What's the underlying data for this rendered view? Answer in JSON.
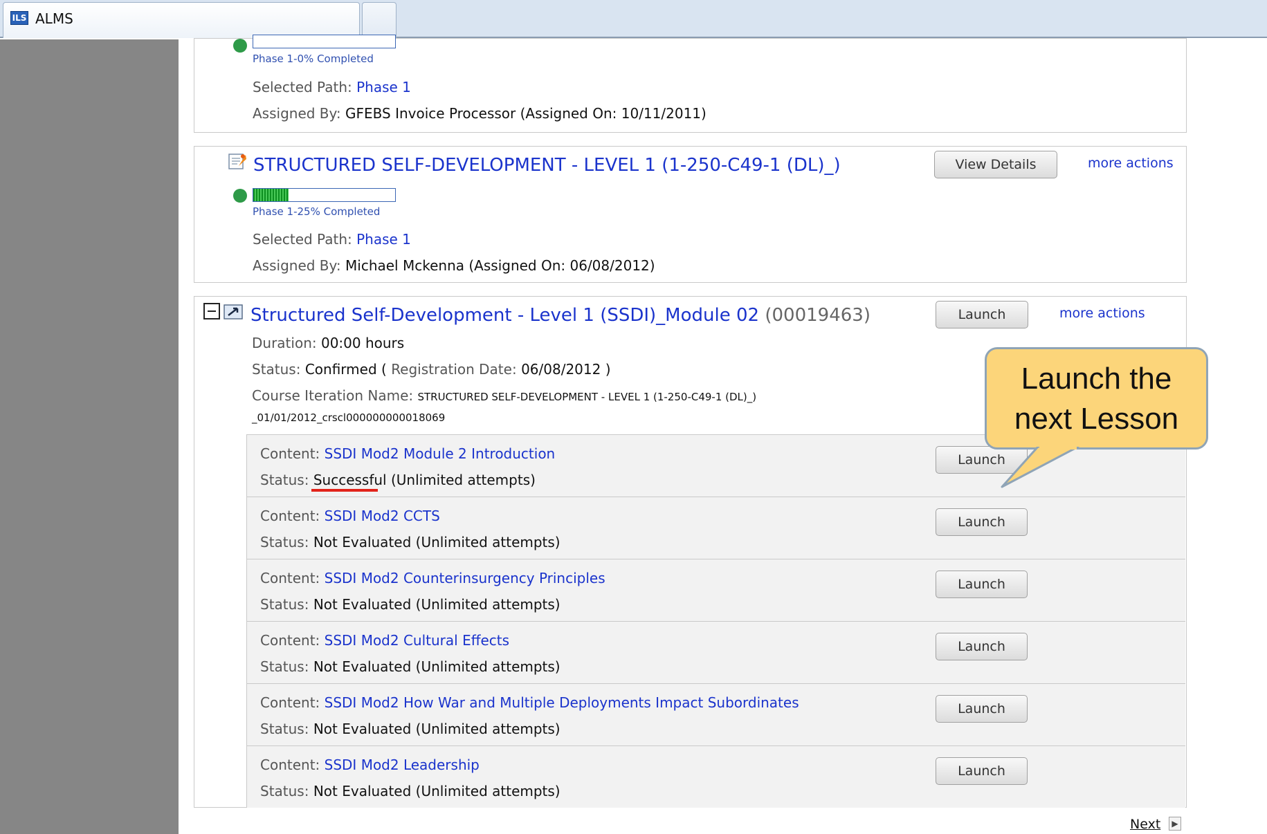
{
  "browser": {
    "tab_title": "ALMS",
    "tab_icon": "ILS"
  },
  "card_top": {
    "progress_label": "Phase 1-0% Completed",
    "progress_percent": 0,
    "selected_path_label": "Selected Path:",
    "selected_path_value": "Phase 1",
    "assigned_by_label": "Assigned By:",
    "assigned_by_value": "GFEBS Invoice Processor (Assigned On: 10/11/2011)"
  },
  "card_ssd": {
    "title": "STRUCTURED SELF-DEVELOPMENT - LEVEL 1 (1-250-C49-1 (DL)_)",
    "view_details": "View Details",
    "more_actions": "more actions",
    "progress_label": "Phase 1-25% Completed",
    "progress_percent": 25,
    "selected_path_label": "Selected Path:",
    "selected_path_value": "Phase 1",
    "assigned_by_label": "Assigned By:",
    "assigned_by_value": "Michael Mckenna (Assigned On: 06/08/2012)"
  },
  "module": {
    "title": "Structured Self-Development - Level 1 (SSDI)_Module 02",
    "code": "(00019463)",
    "launch": "Launch",
    "more_actions": "more actions",
    "duration_label": "Duration:",
    "duration_value": "00:00 hours",
    "status_label": "Status:",
    "status_value": "Confirmed",
    "paren_open": "(",
    "reg_label": "Registration Date:",
    "reg_value": "06/08/2012",
    "paren_close": ")",
    "iteration_label": "Course Iteration Name:",
    "iteration_value_1": "STRUCTURED SELF-DEVELOPMENT - LEVEL 1 (1-250-C49-1 (DL)_)",
    "iteration_value_2": "_01/01/2012_crscl000000000018069",
    "contents": [
      {
        "content_label": "Content:",
        "name": "SSDI Mod2 Module 2 Introduction",
        "status_label": "Status:",
        "status": "Successful",
        "attempts": "(Unlimited attempts)",
        "launch": "Launch"
      },
      {
        "content_label": "Content:",
        "name": "SSDI Mod2 CCTS",
        "status_label": "Status:",
        "status": "Not Evaluated",
        "attempts": "(Unlimited attempts)",
        "launch": "Launch"
      },
      {
        "content_label": "Content:",
        "name": "SSDI Mod2 Counterinsurgency Principles",
        "status_label": "Status:",
        "status": "Not Evaluated",
        "attempts": "(Unlimited attempts)",
        "launch": "Launch"
      },
      {
        "content_label": "Content:",
        "name": "SSDI Mod2 Cultural Effects",
        "status_label": "Status:",
        "status": "Not Evaluated",
        "attempts": "(Unlimited attempts)",
        "launch": "Launch"
      },
      {
        "content_label": "Content:",
        "name": "SSDI Mod2 How War and Multiple Deployments Impact Subordinates",
        "status_label": "Status:",
        "status": "Not Evaluated",
        "attempts": "(Unlimited attempts)",
        "launch": "Launch"
      },
      {
        "content_label": "Content:",
        "name": "SSDI Mod2 Leadership",
        "status_label": "Status:",
        "status": "Not Evaluated",
        "attempts": "(Unlimited attempts)",
        "launch": "Launch"
      }
    ]
  },
  "callout": {
    "line1": "Launch the",
    "line2": "next Lesson"
  },
  "pagination": {
    "next": "Next"
  },
  "colors": {
    "link": "#1a33cc",
    "progress_green": "#2e9a48",
    "callout_fill": "#fcd57a",
    "underline_red": "#e2231a",
    "sidebar_gray": "#868686"
  }
}
